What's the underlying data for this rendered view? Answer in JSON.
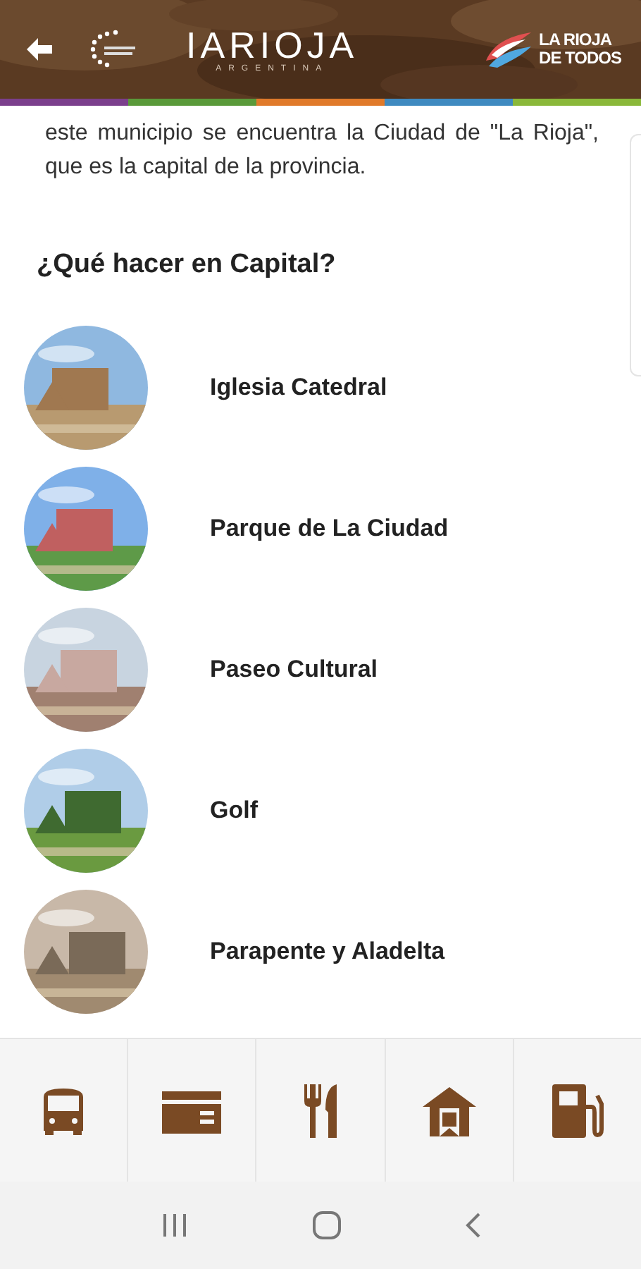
{
  "header": {
    "logo_main": "IARIOJA",
    "logo_sub": "ARGENTINA",
    "logo_right": [
      "LA RIOJA",
      "DE TODOS"
    ]
  },
  "intro": "este municipio se encuentra la Ciudad de \"La Rioja\", que es la capital de la provincia.",
  "heading": "¿Qué hacer en Capital?",
  "places": [
    {
      "name": "Iglesia Catedral",
      "kind": "picture"
    },
    {
      "name": "Parque de La Ciudad",
      "kind": "picture"
    },
    {
      "name": "Paseo Cultural",
      "kind": "picture"
    },
    {
      "name": "Golf",
      "kind": "picture"
    },
    {
      "name": "Parapente y Aladelta",
      "kind": "picture"
    }
  ],
  "bottom_nav": [
    {
      "kind": "bus"
    },
    {
      "kind": "card"
    },
    {
      "kind": "food"
    },
    {
      "kind": "house"
    },
    {
      "kind": "fuel"
    }
  ]
}
